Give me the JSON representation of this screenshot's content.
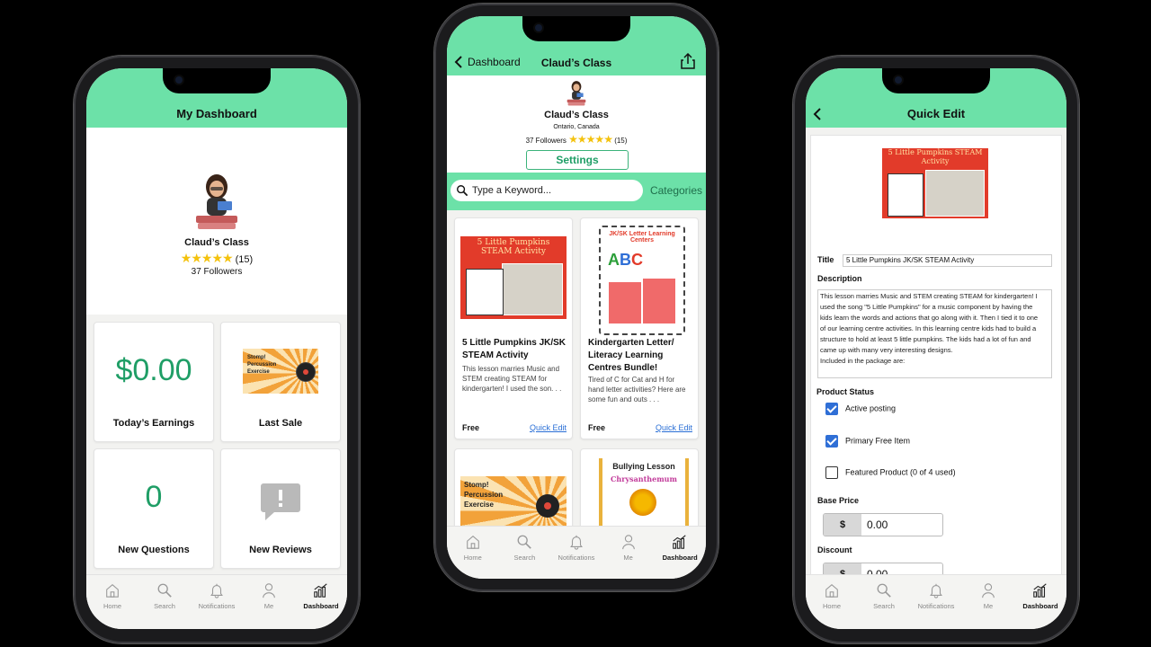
{
  "phone1": {
    "header_title": "My Dashboard",
    "store_name": "Claud’s Class",
    "rating_count": "(15)",
    "followers": "37 Followers",
    "tiles": [
      {
        "value": "$0.00",
        "label": "Today’s Earnings"
      },
      {
        "label": "Last Sale",
        "thumb_lines": [
          "Stomp!",
          "Percussion",
          "Exercise"
        ]
      },
      {
        "value": "0",
        "label": "New Questions"
      },
      {
        "label": "New Reviews"
      }
    ]
  },
  "phone2": {
    "back_label": "Dashboard",
    "header_title": "Claud’s Class",
    "store_name": "Claud’s Class",
    "location": "Ontario, Canada",
    "followers": "37 Followers",
    "rating_count": "(15)",
    "settings_label": "Settings",
    "search_placeholder": "Type a Keyword...",
    "categories_label": "Categories",
    "products": [
      {
        "thumb_title": "5 Little Pumpkins STEAM Activity",
        "title": "5 Little Pumpkins JK/SK STEAM Activity",
        "desc": "This lesson marries Music and STEM creating STEAM for kindergarten! I used the son. . .",
        "price": "Free",
        "action": "Quick Edit"
      },
      {
        "thumb_title": "JK/SK Letter Learning Centers",
        "title": "Kindergarten Letter/ Literacy Learning Centres Bundle!",
        "desc": "Tired of C for Cat and H for hand letter activities? Here are some fun and outs . . .",
        "price": "Free",
        "action": "Quick Edit"
      },
      {
        "thumb_lines": [
          "Stomp!",
          "Percussion",
          "Exercise"
        ]
      },
      {
        "thumb_title": "Bullying Lesson",
        "thumb_sub": "Chrysanthemum"
      }
    ]
  },
  "phone3": {
    "header_title": "Quick Edit",
    "thumb_title": "5 Little Pumpkins STEAM Activity",
    "title_label": "Title",
    "title_value": "5 Little Pumpkins JK/SK STEAM Activity",
    "description_label": "Description",
    "description_value": "This lesson marries Music and STEM creating STEAM for kindergarten! I used the song \"5 Little Pumpkins\" for a music component by having the kids learn the words and actions that go along with it. Then I tied it to one of our learning centre activities. In this learning centre kids had to build a structure to hold at least 5 little pumpkins. The kids had a lot of fun and came up with many very interesting designs.\nIncluded in the package are:",
    "status_label": "Product Status",
    "checkboxes": [
      {
        "label": "Active posting",
        "checked": true
      },
      {
        "label": "Primary Free Item",
        "checked": true
      },
      {
        "label": "Featured Product (0 of 4 used)",
        "checked": false
      }
    ],
    "base_price_label": "Base Price",
    "currency": "$",
    "base_price_value": "0.00",
    "discount_label": "Discount",
    "discount_value": "0.00"
  },
  "tabbar": [
    "Home",
    "Search",
    "Notifications",
    "Me",
    "Dashboard"
  ],
  "colors": {
    "accent": "#6ce1a8",
    "money": "#1f9e66",
    "link": "#2a6fd6",
    "star": "#f4c20d",
    "checkbox": "#2f6fd6"
  }
}
